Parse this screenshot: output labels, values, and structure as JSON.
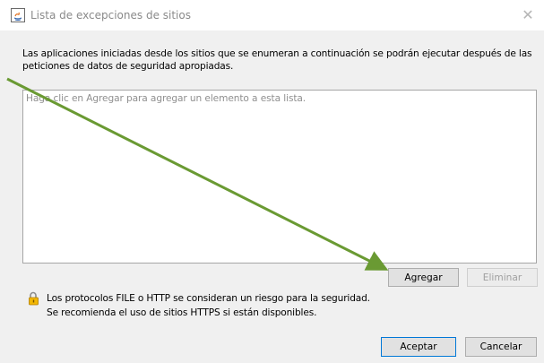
{
  "window": {
    "title": "Lista de excepciones de sitios",
    "close_glyph": "✕",
    "title_icon": "java-icon"
  },
  "main": {
    "description": "Las aplicaciones iniciadas desde los sitios que se enumeran a continuación se podrán ejecutar después de las peticiones de datos de seguridad apropiadas.",
    "list_placeholder": "Haga clic en Agregar para agregar un elemento a esta lista.",
    "add_label": "Agregar",
    "remove_label": "Eliminar",
    "remove_enabled": false,
    "warning_icon": "lock-icon",
    "warning_line1": "Los protocolos FILE o HTTP se consideran un riesgo para la seguridad.",
    "warning_line2": "Se recomienda el uso de sitios HTTPS si están disponibles."
  },
  "footer": {
    "accept_label": "Aceptar",
    "cancel_label": "Cancelar"
  },
  "colors": {
    "annotation_arrow": "#6a9a33",
    "accent": "#0078d7",
    "dialog_background": "#f0f0f0"
  }
}
